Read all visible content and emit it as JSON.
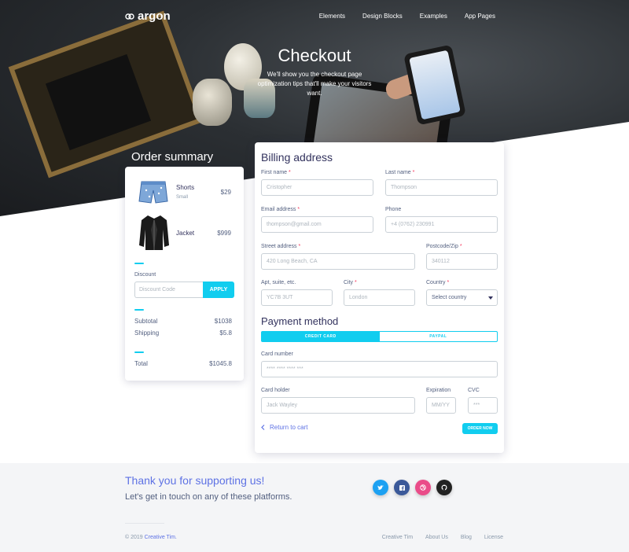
{
  "nav": {
    "brand": "argon",
    "links": [
      "Elements",
      "Design Blocks",
      "Examples",
      "App Pages"
    ]
  },
  "hero": {
    "title": "Checkout",
    "subtitle": "We'll show you the checkout page optimization tips that'll make your visitors want."
  },
  "order_summary": {
    "title": "Order summary",
    "items": [
      {
        "name": "Shorts",
        "size": "Small",
        "price": "$29"
      },
      {
        "name": "Jacket",
        "size": "",
        "price": "$999"
      }
    ],
    "discount_label": "Discount",
    "discount_placeholder": "Discount Code",
    "apply_label": "APPLY",
    "subtotal_label": "Subtotal",
    "subtotal_value": "$1038",
    "shipping_label": "Shipping",
    "shipping_value": "$5.8",
    "total_label": "Total",
    "total_value": "$1045.8"
  },
  "billing": {
    "title": "Billing address",
    "first_name_label": "First name",
    "first_name_placeholder": "Cristopher",
    "last_name_label": "Last name",
    "last_name_placeholder": "Thompson",
    "email_label": "Email address",
    "email_placeholder": "thompson@gmail.com",
    "phone_label": "Phone",
    "phone_placeholder": "+4 (0762) 230991",
    "street_label": "Street address",
    "street_placeholder": "420 Long Beach, CA",
    "postcode_label": "Postcode/Zip",
    "postcode_placeholder": "340112",
    "apt_label": "Apt, suite, etc.",
    "apt_placeholder": "YC7B 3UT",
    "city_label": "City",
    "city_placeholder": "London",
    "country_label": "Country",
    "country_selected": "Select country",
    "required_mark": "*"
  },
  "payment": {
    "title": "Payment method",
    "tabs": [
      "CREDIT CARD",
      "PAYPAL"
    ],
    "card_number_label": "Card number",
    "card_number_placeholder": "**** **** **** ***",
    "card_holder_label": "Card holder",
    "card_holder_placeholder": "Jack Wayley",
    "expiration_label": "Expiration",
    "expiration_placeholder": "MM/YY",
    "cvc_label": "CVC",
    "cvc_placeholder": "***",
    "return_label": "Return to cart",
    "order_label": "ORDER NOW"
  },
  "footer": {
    "thanks": "Thank you for supporting us!",
    "touch": "Let's get in touch on any of these platforms.",
    "social": [
      {
        "name": "twitter",
        "color": "#1da1f2"
      },
      {
        "name": "facebook",
        "color": "#3b5999"
      },
      {
        "name": "dribbble",
        "color": "#ea4c89"
      },
      {
        "name": "github",
        "color": "#222222"
      }
    ],
    "copyright_prefix": "© 2019",
    "copyright_brand": "Creative Tim.",
    "links": [
      "Creative Tim",
      "About Us",
      "Blog",
      "License"
    ]
  },
  "colors": {
    "primary": "#5e72e4",
    "info": "#11cdef",
    "required": "#f5365c"
  }
}
